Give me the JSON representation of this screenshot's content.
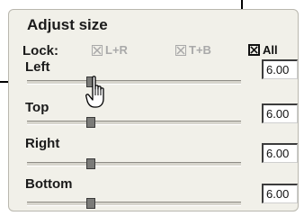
{
  "panel": {
    "title": "Adjust size",
    "lock": {
      "label": "Lock:",
      "options": [
        {
          "label": "L+R",
          "enabled": false
        },
        {
          "label": "T+B",
          "enabled": false
        },
        {
          "label": "All",
          "enabled": true
        }
      ]
    },
    "rows": [
      {
        "label": "Left",
        "value": "6.00",
        "slider_fraction": 0.37
      },
      {
        "label": "Top",
        "value": "6.00",
        "slider_fraction": 0.37
      },
      {
        "label": "Right",
        "value": "6.00",
        "slider_fraction": 0.37
      },
      {
        "label": "Bottom",
        "value": "6.00",
        "slider_fraction": 0.37
      }
    ]
  },
  "colors": {
    "panel_bg": "#f1f0e9",
    "disabled_text": "#a9a9a9",
    "thumb": "#7b7b78"
  },
  "icons": {
    "cursor": "hand-pointer-icon",
    "checkbox": "checkbox-checked-icon"
  }
}
